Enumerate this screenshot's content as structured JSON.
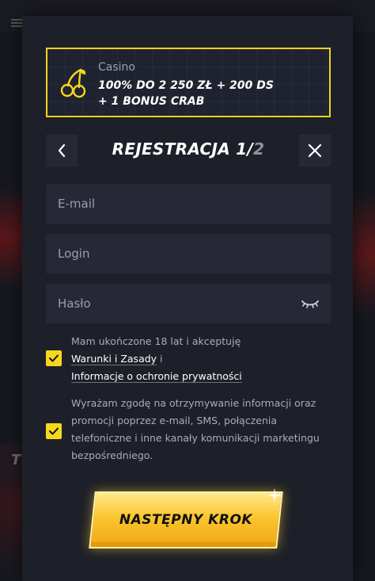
{
  "promo": {
    "category": "Casino",
    "offer_line1": "100% DO 2 250 ZŁ + 200 DS",
    "offer_line2": "+ 1 BONUS CRAB"
  },
  "header": {
    "title_main": "REJESTRACJA 1/",
    "title_total": "2"
  },
  "form": {
    "email_placeholder": "E-mail",
    "login_placeholder": "Login",
    "password_placeholder": "Hasło"
  },
  "consents": {
    "age_text": "Mam ukończone 18 lat i akceptuję",
    "terms_link": "Warunki i Zasady",
    "conjunction": " i",
    "privacy_link": "Informacje o ochronie prywatności",
    "marketing_text": "Wyrażam zgodę na otrzymywanie informacji oraz promocji poprzez e-mail, SMS, połączenia telefoniczne i inne kanały komunikacji marketingu bezpośredniego."
  },
  "actions": {
    "next_label": "NASTĘPNY KROK"
  },
  "colors": {
    "accent": "#f5d81c",
    "panel": "#1e2029",
    "field": "#262935"
  }
}
